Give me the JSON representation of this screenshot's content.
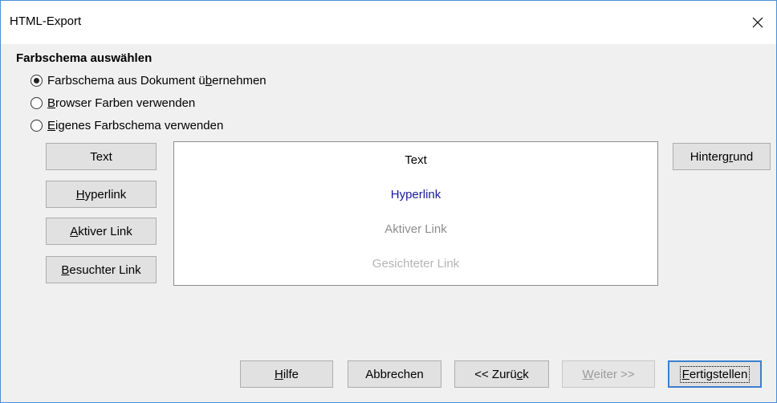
{
  "window": {
    "title": "HTML-Export",
    "close_symbol": "close-icon"
  },
  "color_scheme": {
    "heading": "Farbschema auswählen",
    "options": [
      {
        "pre": "Farbschema aus Dokument ü",
        "mnemonic": "b",
        "post": "ernehmen",
        "selected": true
      },
      {
        "pre": "",
        "mnemonic": "B",
        "post": "rowser Farben verwenden",
        "selected": false
      },
      {
        "pre": "",
        "mnemonic": "E",
        "post": "igenes Farbschema verwenden",
        "selected": false
      }
    ]
  },
  "color_buttons": {
    "text": {
      "pre": "Text",
      "mnemonic": "",
      "post": ""
    },
    "hyperlink": {
      "pre": "",
      "mnemonic": "H",
      "post": "yperlink"
    },
    "active_link": {
      "pre": "",
      "mnemonic": "A",
      "post": "ktiver Link"
    },
    "visited_link": {
      "pre": "",
      "mnemonic": "B",
      "post": "esuchter Link"
    },
    "background": {
      "pre": "Hinterg",
      "mnemonic": "r",
      "post": "und"
    }
  },
  "preview": {
    "text": "Text",
    "hyperlink": "Hyperlink",
    "active_link": "Aktiver Link",
    "visited_link": "Gesichteter Link",
    "colors": {
      "text": "#000000",
      "hyperlink": "#1a1a9a",
      "active_link": "#8c8c8c",
      "visited_link": "#b4b4b4"
    }
  },
  "footer": {
    "help": {
      "pre": "",
      "mnemonic": "H",
      "post": "ilfe"
    },
    "cancel": {
      "pre": "Abbrechen",
      "mnemonic": "",
      "post": ""
    },
    "back": {
      "pre": "<< Zurü",
      "mnemonic": "c",
      "post": "k"
    },
    "next": {
      "pre": "",
      "mnemonic": "W",
      "post": "eiter >>"
    },
    "finish": {
      "pre": "",
      "mnemonic": "F",
      "post": "ertigstellen"
    }
  },
  "theme": {
    "window_border": "#4a8fd6",
    "dialog_bg": "#f0f0f0",
    "button_bg": "#e1e1e1",
    "default_button_border": "#3c7fd1"
  }
}
